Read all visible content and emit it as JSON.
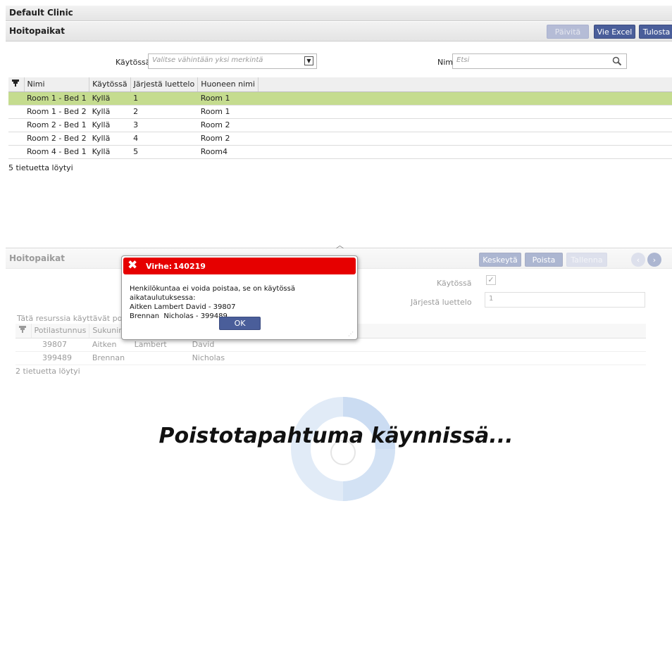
{
  "clinic": "Default Clinic",
  "top": {
    "title": "Hoitopaikat",
    "buttons": {
      "refresh": "Päivitä",
      "excel": "Vie Excel",
      "print": "Tulosta"
    },
    "filters": {
      "active_label": "Käytössä",
      "active_placeholder": "Valitse vähintään yksi merkintä",
      "name_label": "Nimi",
      "name_placeholder": "Etsi"
    },
    "table": {
      "headers": [
        "Nimi",
        "Käytössä",
        "Järjestä luettelo",
        "Huoneen nimi"
      ],
      "rows": [
        [
          "Room 1 - Bed 1",
          "Kyllä",
          "1",
          "Room 1"
        ],
        [
          "Room 1 - Bed 2",
          "Kyllä",
          "2",
          "Room 1"
        ],
        [
          "Room 2 - Bed 1",
          "Kyllä",
          "3",
          "Room 2"
        ],
        [
          "Room 2 - Bed 2",
          "Kyllä",
          "4",
          "Room 2"
        ],
        [
          "Room 4 - Bed 1",
          "Kyllä",
          "5",
          "Room4"
        ]
      ]
    },
    "count": "5 tietuetta löytyi"
  },
  "bottom": {
    "title": "Hoitopaikat",
    "buttons": {
      "cancel": "Keskeytä",
      "delete": "Poista",
      "save": "Tallenna"
    },
    "active_label": "Käytössä",
    "order_label": "Järjestä luettelo",
    "order_value": "1",
    "patients_label": "Tätä resurssia käyttävät potila",
    "patients_headers": [
      "Potilastunnus",
      "Sukunimi",
      "",
      ""
    ],
    "patients": [
      [
        "39807",
        "Aitken",
        "Lambert",
        "David"
      ],
      [
        "399489",
        "Brennan",
        "",
        "Nicholas"
      ]
    ],
    "count": "2 tietuetta löytyi"
  },
  "dialog": {
    "title_prefix": "Virhe:",
    "code": "140219",
    "message": "Henkilökuntaa ei voida poistaa, se on käytössä aikataulutuksessa:",
    "lines": [
      "Aitken Lambert David - 39807",
      "Brennan  Nicholas - 399489"
    ],
    "ok": "OK"
  },
  "loading": "Poistotapahtuma käynnissä...",
  "colors": {
    "selected_row": "#c5dc8f",
    "button": "#4a5e9a",
    "error": "#e60000"
  }
}
